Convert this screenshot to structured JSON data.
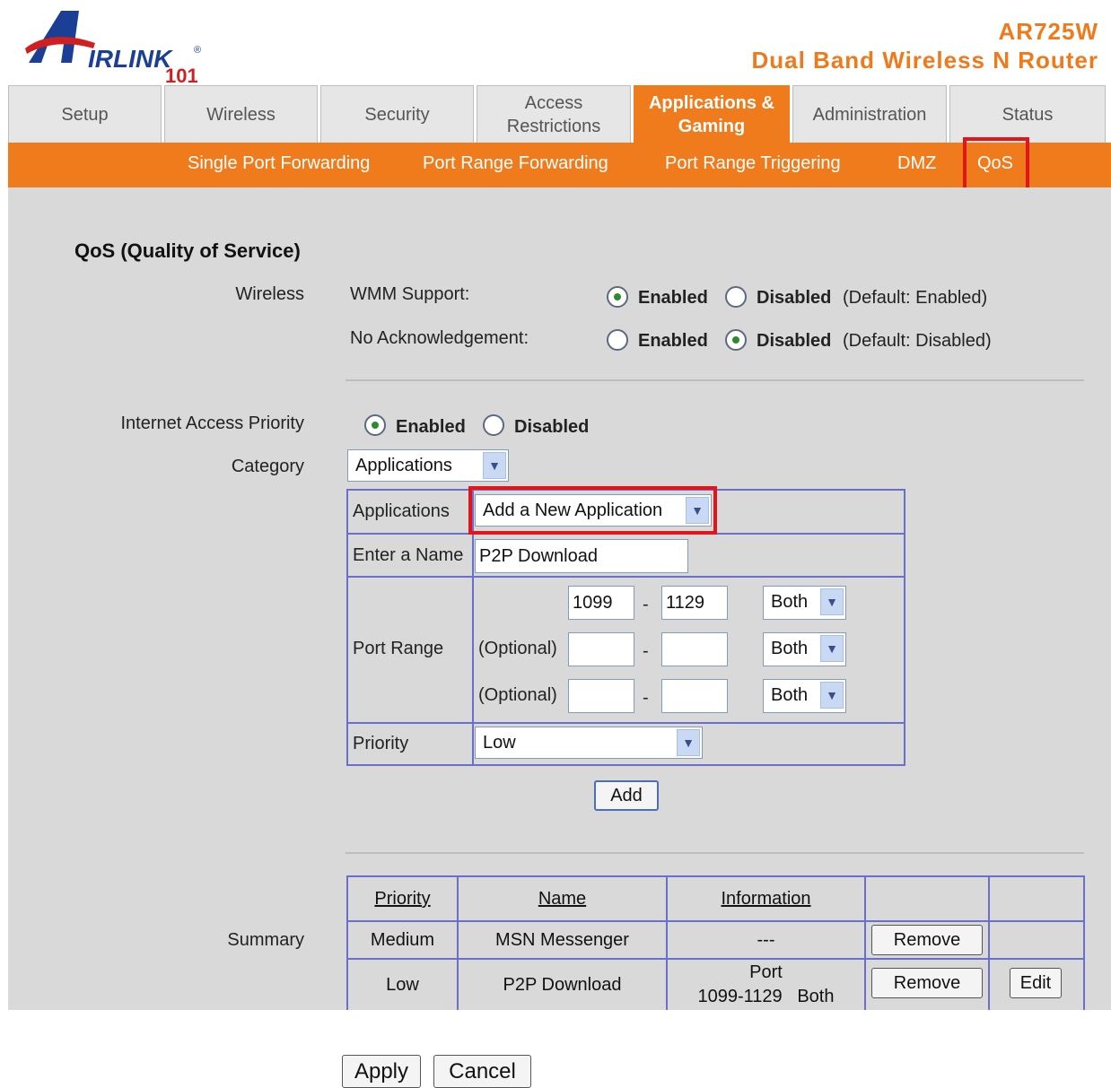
{
  "brand": {
    "logo_text": "IRLINK",
    "logo_num": "101",
    "logo_reg": "®"
  },
  "header": {
    "model": "AR725W",
    "product": "Dual Band Wireless N Router"
  },
  "tabs": [
    {
      "label": "Setup"
    },
    {
      "label": "Wireless"
    },
    {
      "label": "Security"
    },
    {
      "label": "Access Restrictions"
    },
    {
      "label": "Applications & Gaming"
    },
    {
      "label": "Administration"
    },
    {
      "label": "Status"
    }
  ],
  "subnav": [
    {
      "label": "Single Port Forwarding"
    },
    {
      "label": "Port Range Forwarding"
    },
    {
      "label": "Port Range Triggering"
    },
    {
      "label": "DMZ"
    },
    {
      "label": "QoS"
    }
  ],
  "qos": {
    "title": "QoS (Quality of Service)",
    "wireless_label": "Wireless",
    "wmm_label": "WMM Support:",
    "wmm_enabled": "Enabled",
    "wmm_disabled": "Disabled",
    "wmm_default": "(Default: Enabled)",
    "noack_label": "No Acknowledgement:",
    "noack_enabled": "Enabled",
    "noack_disabled": "Disabled",
    "noack_default": "(Default: Disabled)",
    "iap_label": "Internet Access Priority",
    "iap_enabled": "Enabled",
    "iap_disabled": "Disabled",
    "category_label": "Category",
    "category_value": "Applications",
    "applications_label": "Applications",
    "applications_value": "Add a New Application",
    "name_label": "Enter a Name",
    "name_value": "P2P Download",
    "port_range_label": "Port Range",
    "optional_label_1": "(Optional)",
    "optional_label_2": "(Optional)",
    "port1_start": "1099",
    "port1_end": "1129",
    "dash": "-",
    "proto1": "Both",
    "proto2": "Both",
    "proto3": "Both",
    "priority_label": "Priority",
    "priority_value": "Low",
    "add_button": "Add",
    "summary_label": "Summary"
  },
  "summary": {
    "headers": [
      "Priority",
      "Name",
      "Information"
    ],
    "rows": [
      {
        "priority": "Medium",
        "name": "MSN Messenger",
        "info": "---",
        "remove": "Remove"
      },
      {
        "priority": "Low",
        "name": "P2P Download",
        "info_line1": "Port",
        "info_line2": "1099-1129   Both",
        "remove": "Remove",
        "edit": "Edit"
      }
    ]
  },
  "footer": {
    "apply": "Apply",
    "cancel": "Cancel"
  },
  "colors": {
    "accent": "#f07b1d",
    "highlight": "#e3151a",
    "grid": "#6a6fc9",
    "panel": "#d9d9d9"
  }
}
